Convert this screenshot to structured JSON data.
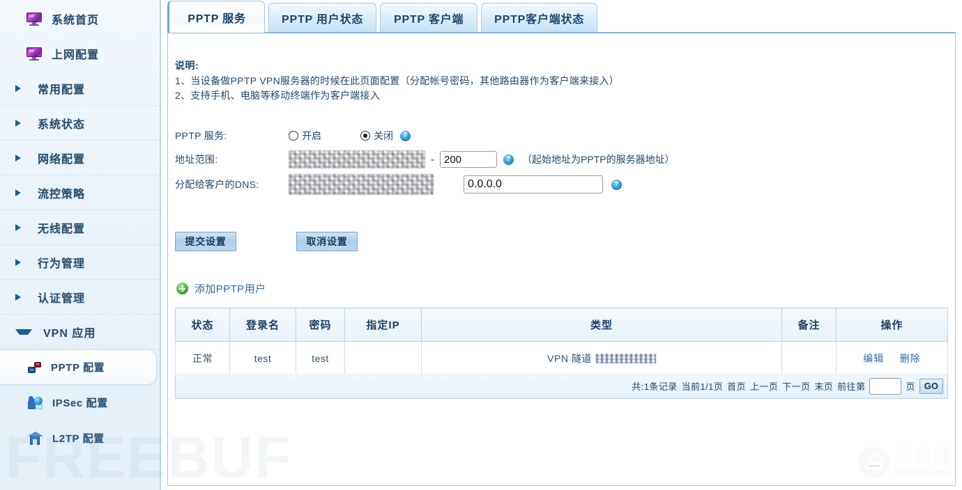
{
  "sidebar": {
    "top_items": [
      {
        "label": "系统首页",
        "icon": "monitor-icon"
      },
      {
        "label": "上网配置",
        "icon": "monitor-icon"
      }
    ],
    "groups": [
      {
        "label": "常用配置",
        "expanded": false
      },
      {
        "label": "系统状态",
        "expanded": false
      },
      {
        "label": "网络配置",
        "expanded": false
      },
      {
        "label": "流控策略",
        "expanded": false
      },
      {
        "label": "无线配置",
        "expanded": false
      },
      {
        "label": "行为管理",
        "expanded": false
      },
      {
        "label": "认证管理",
        "expanded": false
      },
      {
        "label": "VPN 应用",
        "expanded": true
      }
    ],
    "vpn_children": [
      {
        "label": "PPTP 配置",
        "icon": "pptp-icon",
        "selected": true
      },
      {
        "label": "IPSec 配置",
        "icon": "ipsec-icon",
        "selected": false
      },
      {
        "label": "L2TP 配置",
        "icon": "l2tp-icon",
        "selected": false
      }
    ]
  },
  "tabs": [
    {
      "label": "PPTP 服务",
      "active": true
    },
    {
      "label": "PPTP 用户状态",
      "active": false
    },
    {
      "label": "PPTP 客户端",
      "active": false
    },
    {
      "label": "PPTP客户端状态",
      "active": false
    }
  ],
  "notes": {
    "title": "说明:",
    "line1": "1、当设备做PPTP VPN服务器的时候在此页面配置（分配帐号密码，其他路由器作为客户端来接入）",
    "line2": "2、支持手机、电脑等移动终端作为客户端接入"
  },
  "form": {
    "service_label": "PPTP 服务:",
    "radio_on": "开启",
    "radio_off": "关闭",
    "service_value": "关闭",
    "range_label": "地址范围:",
    "range_start_value": "",
    "range_separator": "-",
    "range_end_value": "200",
    "range_hint": "（起始地址为PPTP的服务器地址）",
    "dns_label": "分配给客户的DNS:",
    "dns_primary_value": "",
    "dns_secondary_value": "0.0.0.0",
    "help_icon": "help-icon"
  },
  "buttons": {
    "submit": "提交设置",
    "cancel": "取消设置"
  },
  "add_user": {
    "label": "添加PPTP用户",
    "icon": "plus-circle-icon"
  },
  "table": {
    "headers": [
      "状态",
      "登录名",
      "密码",
      "指定IP",
      "类型",
      "备注",
      "操作"
    ],
    "rows": [
      {
        "status": "正常",
        "login": "test",
        "password": "test",
        "assigned_ip": "",
        "type": "VPN 隧道",
        "remark": "",
        "actions": [
          "编辑",
          "删除"
        ]
      }
    ]
  },
  "pager": {
    "total": "共:1条记录",
    "current": "当前1/1页",
    "first": "首页",
    "prev": "上一页",
    "next": "下一页",
    "last": "末页",
    "goto_prefix": "前往第",
    "goto_value": "",
    "goto_suffix": "页",
    "go": "GO"
  },
  "watermarks": {
    "freebuf": "FREEBUF",
    "router_zh": "路由器",
    "router_en": "luyouqi.com"
  },
  "colors": {
    "accent": "#2e6aa3",
    "tab_border": "#a9c9e2",
    "header_bg": "#e8f2fa",
    "sidebar_bg": "#eaf3fa"
  }
}
